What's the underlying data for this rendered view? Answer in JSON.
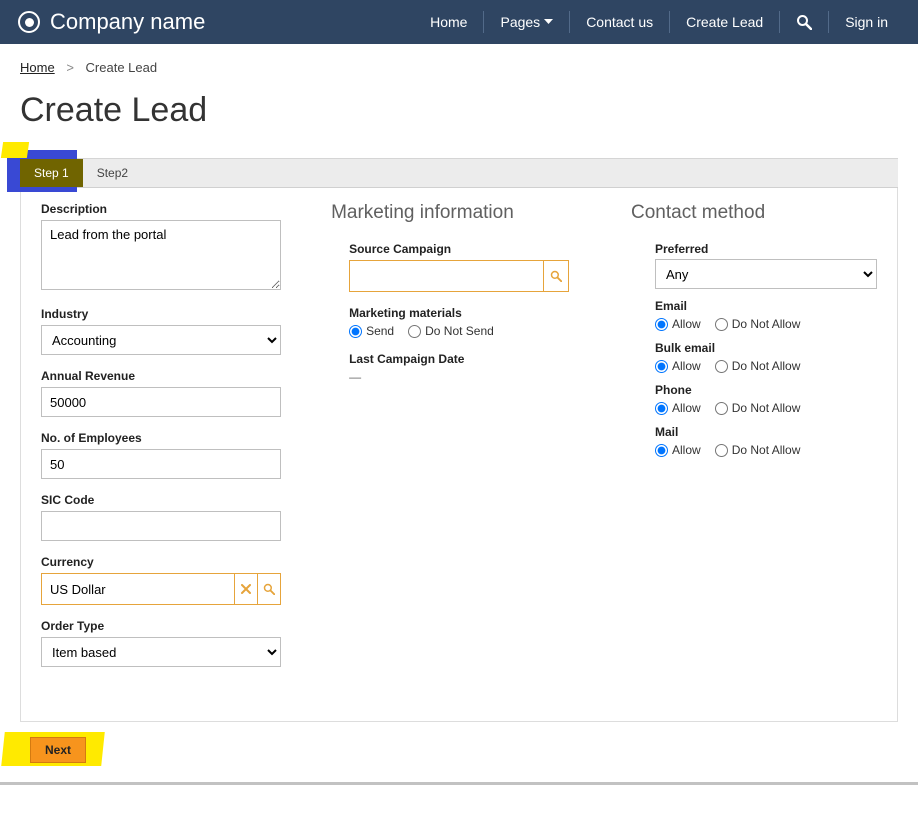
{
  "brand": "Company name",
  "nav": {
    "home": "Home",
    "pages": "Pages",
    "contact": "Contact us",
    "create_lead": "Create Lead",
    "signin": "Sign in"
  },
  "breadcrumb": {
    "home": "Home",
    "current": "Create Lead"
  },
  "page_title": "Create Lead",
  "tabs": {
    "step1": "Step 1",
    "step2": "Step2"
  },
  "left": {
    "description_label": "Description",
    "description_value": "Lead from the portal",
    "industry_label": "Industry",
    "industry_value": "Accounting",
    "annual_revenue_label": "Annual Revenue",
    "annual_revenue_value": "50000",
    "num_employees_label": "No. of Employees",
    "num_employees_value": "50",
    "sic_code_label": "SIC Code",
    "sic_code_value": "",
    "currency_label": "Currency",
    "currency_value": "US Dollar",
    "order_type_label": "Order Type",
    "order_type_value": "Item based"
  },
  "marketing": {
    "heading": "Marketing information",
    "source_campaign_label": "Source Campaign",
    "source_campaign_value": "",
    "marketing_materials_label": "Marketing materials",
    "send": "Send",
    "do_not_send": "Do Not Send",
    "last_campaign_date_label": "Last Campaign Date",
    "last_campaign_date_value": "—"
  },
  "contact": {
    "heading": "Contact method",
    "preferred_label": "Preferred",
    "preferred_value": "Any",
    "allow": "Allow",
    "do_not_allow": "Do Not Allow",
    "email_label": "Email",
    "bulk_email_label": "Bulk email",
    "phone_label": "Phone",
    "mail_label": "Mail"
  },
  "buttons": {
    "next": "Next"
  }
}
